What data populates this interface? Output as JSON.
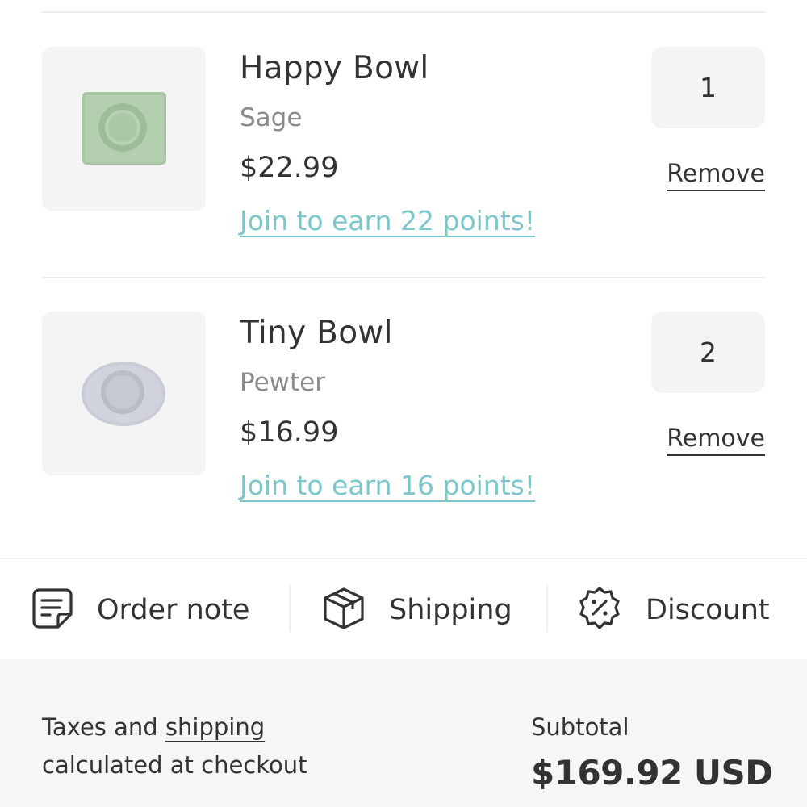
{
  "cart": {
    "items": [
      {
        "name": "Happy Bowl",
        "variant": "Sage",
        "price": "$22.99",
        "points": "Join to earn 22 points!",
        "quantity": "1",
        "remove_label": "Remove",
        "image_color": "#a9c7a5"
      },
      {
        "name": "Tiny Bowl",
        "variant": "Pewter",
        "price": "$16.99",
        "points": "Join to earn 16 points!",
        "quantity": "2",
        "remove_label": "Remove",
        "image_color": "#c9ccd6"
      }
    ]
  },
  "actions": {
    "order_note": {
      "label": "Order note",
      "icon": "note-icon"
    },
    "shipping": {
      "label": "Shipping",
      "icon": "box-icon"
    },
    "discount": {
      "label": "Discount",
      "icon": "discount-badge-icon"
    }
  },
  "summary": {
    "tax_prefix": "Taxes and ",
    "tax_link": "shipping",
    "tax_line2": "calculated at checkout",
    "subtotal_label": "Subtotal",
    "subtotal_value": "$169.92 USD"
  },
  "colors": {
    "accent": "#7cc7c9",
    "text": "#333333",
    "muted": "#8a8a8a",
    "panel": "#f4f4f4"
  }
}
